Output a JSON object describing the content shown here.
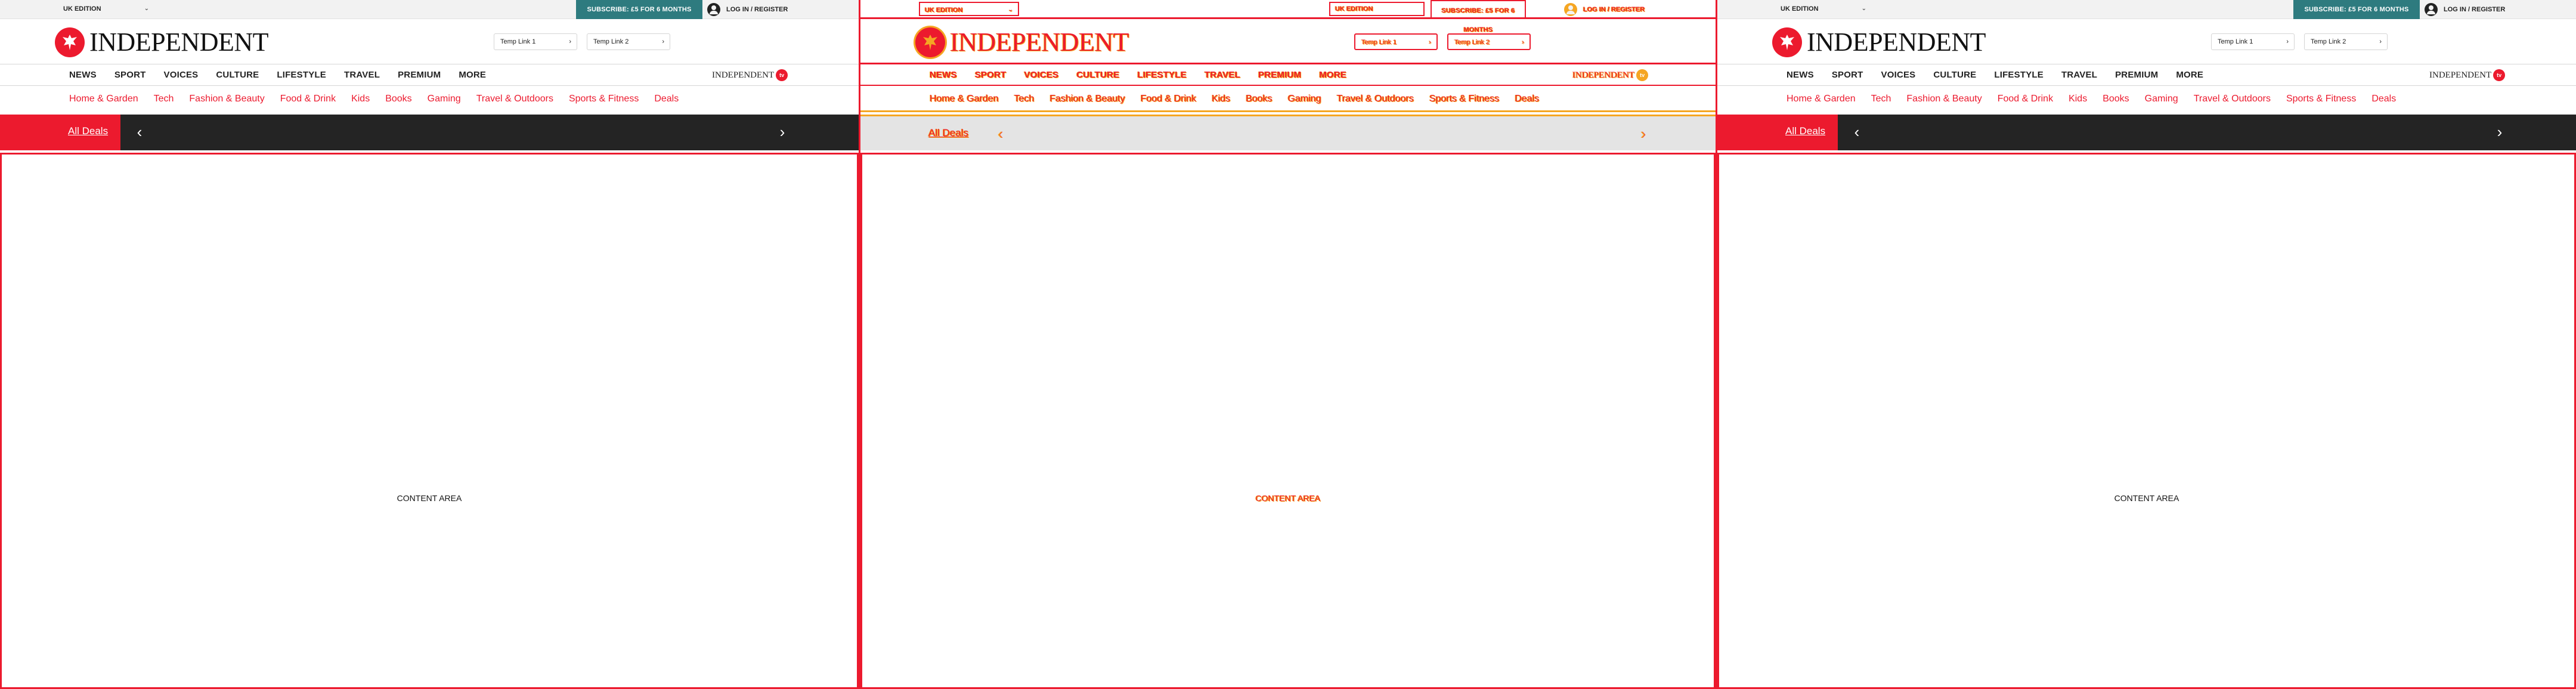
{
  "colors": {
    "brand_red": "#ec1a2e",
    "subscribe_teal": "#2e7b7f",
    "deals_dark": "#242424",
    "debug_orange": "#f5a623"
  },
  "header": {
    "edition": "UK EDITION",
    "subscribe": "SUBSCRIBE: £5 FOR 6 MONTHS",
    "login": "LOG IN / REGISTER",
    "logo_text": "INDEPENDENT",
    "temp_links": [
      "Temp Link 1",
      "Temp Link 2"
    ]
  },
  "nav": {
    "items": [
      "NEWS",
      "SPORT",
      "VOICES",
      "CULTURE",
      "LIFESTYLE",
      "TRAVEL",
      "PREMIUM",
      "MORE"
    ],
    "brand_mini": "INDEPENDENT",
    "tv_badge": "tv"
  },
  "sub_nav": {
    "items": [
      "Home & Garden",
      "Tech",
      "Fashion & Beauty",
      "Food & Drink",
      "Kids",
      "Books",
      "Gaming",
      "Travel & Outdoors",
      "Sports & Fitness",
      "Deals"
    ]
  },
  "deals": {
    "all_deals": "All Deals",
    "prev": "‹",
    "next": "›"
  },
  "content": {
    "label": "CONTENT AREA"
  },
  "icons": [
    "eagle-logo-icon",
    "user-icon",
    "chevron-down-icon",
    "chevron-left-icon",
    "chevron-right-icon",
    "arrow-right-icon"
  ]
}
